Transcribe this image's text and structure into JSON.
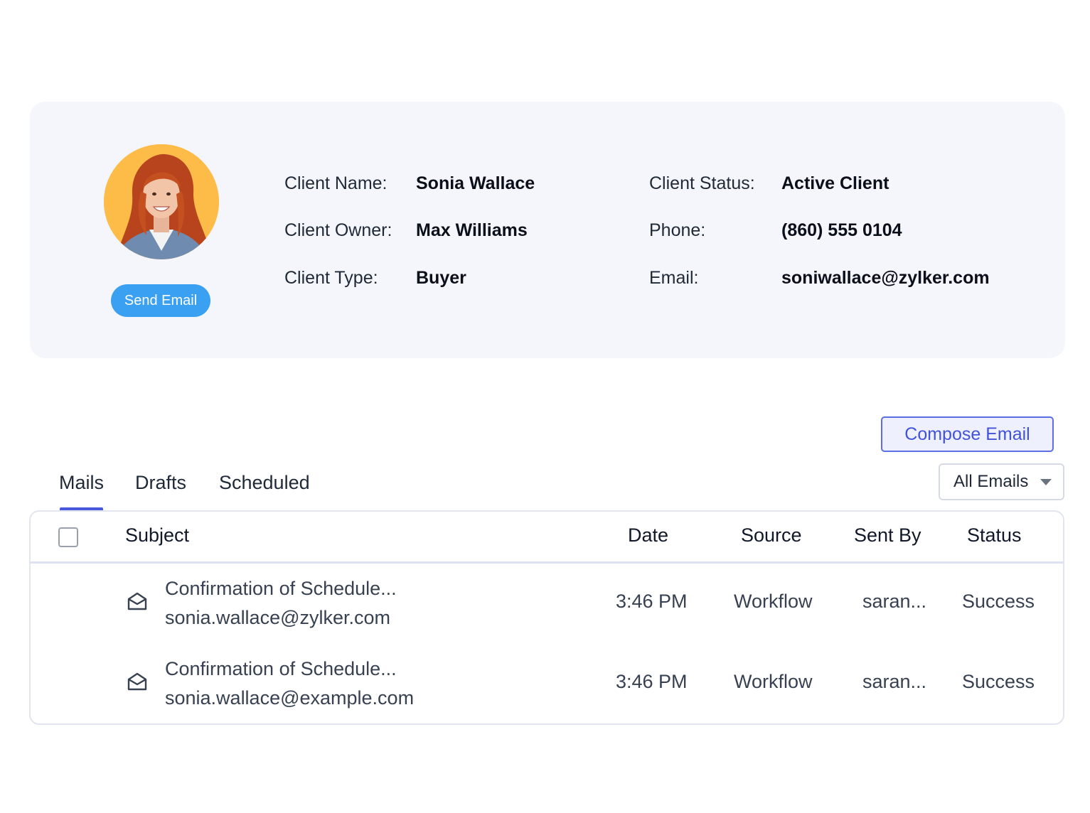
{
  "client": {
    "avatar_icon": "avatar-photo",
    "send_email_label": "Send Email",
    "fields": [
      {
        "label": "Client Name:",
        "value": "Sonia Wallace"
      },
      {
        "label": "Client Owner:",
        "value": "Max Williams"
      },
      {
        "label": "Client Type:",
        "value": "Buyer"
      },
      {
        "label": "Client Status:",
        "value": "Active Client"
      },
      {
        "label": "Phone:",
        "value": "(860) 555 0104"
      },
      {
        "label": "Email:",
        "value": "soniwallace@zylker.com"
      }
    ]
  },
  "actions": {
    "compose_label": "Compose Email",
    "filter_selected": "All Emails"
  },
  "tabs": [
    {
      "label": "Mails",
      "active": true
    },
    {
      "label": "Drafts",
      "active": false
    },
    {
      "label": "Scheduled",
      "active": false
    }
  ],
  "table": {
    "headers": {
      "subject": "Subject",
      "date": "Date",
      "source": "Source",
      "sent_by": "Sent By",
      "status": "Status"
    },
    "rows": [
      {
        "icon": "mail-open-icon",
        "subject": "Confirmation of Schedule...",
        "email": "sonia.wallace@zylker.com",
        "date": "3:46 PM",
        "source": "Workflow",
        "sent_by": "saran...",
        "status": "Success"
      },
      {
        "icon": "mail-open-icon",
        "subject": "Confirmation of Schedule...",
        "email": "sonia.wallace@example.com",
        "date": "3:46 PM",
        "source": "Workflow",
        "sent_by": "saran...",
        "status": "Success"
      }
    ]
  },
  "colors": {
    "card_bg": "#f5f6fc",
    "send_button": "#3aa0f2",
    "accent": "#4857dc",
    "avatar_bg": "#fdbb48"
  }
}
